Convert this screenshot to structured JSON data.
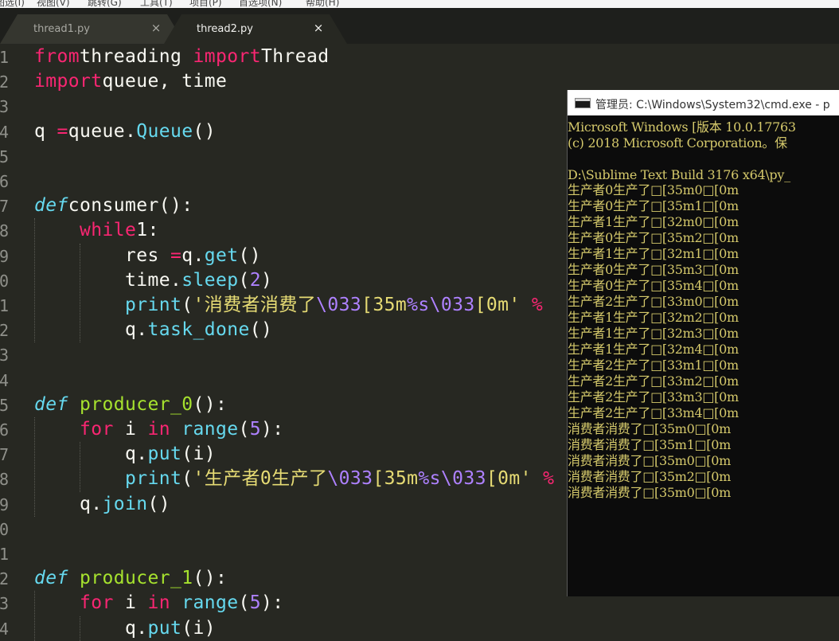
{
  "menu_bar": {
    "items": [
      "图选(I)",
      "视图(V)",
      "跳转(G)",
      "工具(T)",
      "项目(P)",
      "首选项(N)",
      "帮助(H)"
    ]
  },
  "tabs": [
    {
      "label": "thread1.py",
      "active": false
    },
    {
      "label": "thread2.py",
      "active": true
    }
  ],
  "tab_close_glyph": "×",
  "editor": {
    "line_numbers": [
      "1",
      "2",
      "3",
      "4",
      "5",
      "6",
      "7",
      "8",
      "9",
      "0",
      "1",
      "2",
      "3",
      "4",
      "5",
      "6",
      "7",
      "8",
      "9",
      "0",
      "1",
      "2",
      "3",
      "4"
    ],
    "lines": [
      [
        [
          "kw",
          "from"
        ],
        [
          "",
          "threading "
        ],
        [
          "kw",
          "import"
        ],
        [
          "",
          "Thread"
        ]
      ],
      [
        [
          "kw",
          "import"
        ],
        [
          "",
          "queue, time"
        ]
      ],
      [],
      [
        [
          "",
          "q "
        ],
        [
          "kw",
          "="
        ],
        [
          "",
          "queue."
        ],
        [
          "bi",
          "Queue"
        ],
        [
          "",
          "()"
        ]
      ],
      [],
      [],
      [
        [
          "def",
          "def"
        ],
        [
          "",
          "consumer():"
        ]
      ],
      [
        [
          "",
          "    "
        ],
        [
          "kw",
          "while"
        ],
        [
          "",
          "1:"
        ]
      ],
      [
        [
          "",
          "        res "
        ],
        [
          "kw",
          "="
        ],
        [
          "",
          "q."
        ],
        [
          "bi",
          "get"
        ],
        [
          "",
          "()"
        ]
      ],
      [
        [
          "",
          "        time."
        ],
        [
          "bi",
          "sleep"
        ],
        [
          "",
          "("
        ],
        [
          "num",
          "2"
        ],
        [
          "",
          ")"
        ]
      ],
      [
        [
          "",
          "        "
        ],
        [
          "bi",
          "print"
        ],
        [
          "",
          "("
        ],
        [
          "str",
          "'消费者消费了"
        ],
        [
          "esc",
          "\\033"
        ],
        [
          "str",
          "[35m"
        ],
        [
          "esc",
          "%s"
        ],
        [
          "esc",
          "\\033"
        ],
        [
          "str",
          "[0m'"
        ],
        [
          "kw",
          " %"
        ]
      ],
      [
        [
          "",
          "        q."
        ],
        [
          "bi",
          "task_done"
        ],
        [
          "",
          "()"
        ]
      ],
      [],
      [],
      [
        [
          "def",
          "def"
        ],
        [
          "fn",
          " producer_0"
        ],
        [
          "",
          "():"
        ]
      ],
      [
        [
          "",
          "    "
        ],
        [
          "kw",
          "for"
        ],
        [
          "",
          " i "
        ],
        [
          "kw",
          "in"
        ],
        [
          "",
          " "
        ],
        [
          "bi",
          "range"
        ],
        [
          "",
          "("
        ],
        [
          "num",
          "5"
        ],
        [
          "",
          "):"
        ]
      ],
      [
        [
          "",
          "        q."
        ],
        [
          "bi",
          "put"
        ],
        [
          "",
          "(i)"
        ]
      ],
      [
        [
          "",
          "        "
        ],
        [
          "bi",
          "print"
        ],
        [
          "",
          "("
        ],
        [
          "str",
          "'生产者0生产了"
        ],
        [
          "esc",
          "\\033"
        ],
        [
          "str",
          "[35m"
        ],
        [
          "esc",
          "%s"
        ],
        [
          "esc",
          "\\033"
        ],
        [
          "str",
          "[0m'"
        ],
        [
          "kw",
          " %"
        ]
      ],
      [
        [
          "",
          "    q."
        ],
        [
          "bi",
          "join"
        ],
        [
          "",
          "()"
        ]
      ],
      [],
      [],
      [
        [
          "def",
          "def"
        ],
        [
          "fn",
          " producer_1"
        ],
        [
          "",
          "():"
        ]
      ],
      [
        [
          "",
          "    "
        ],
        [
          "kw",
          "for"
        ],
        [
          "",
          " i "
        ],
        [
          "kw",
          "in"
        ],
        [
          "",
          " "
        ],
        [
          "bi",
          "range"
        ],
        [
          "",
          "("
        ],
        [
          "num",
          "5"
        ],
        [
          "",
          "):"
        ]
      ],
      [
        [
          "",
          "        q."
        ],
        [
          "bi",
          "put"
        ],
        [
          "",
          "(i)"
        ]
      ]
    ]
  },
  "terminal": {
    "title": "管理员: C:\\Windows\\System32\\cmd.exe - p",
    "lines": [
      "Microsoft Windows [版本 10.0.17763",
      "(c) 2018 Microsoft Corporation。保",
      "",
      "D:\\Sublime Text Build 3176 x64\\py_",
      "生产者0生产了□[35m0□[0m",
      "生产者0生产了□[35m1□[0m",
      "生产者1生产了□[32m0□[0m",
      "生产者0生产了□[35m2□[0m",
      "生产者1生产了□[32m1□[0m",
      "生产者0生产了□[35m3□[0m",
      "生产者0生产了□[35m4□[0m",
      "生产者2生产了□[33m0□[0m",
      "生产者1生产了□[32m2□[0m",
      "生产者1生产了□[32m3□[0m",
      "生产者1生产了□[32m4□[0m",
      "生产者2生产了□[33m1□[0m",
      "生产者2生产了□[33m2□[0m",
      "生产者2生产了□[33m3□[0m",
      "生产者2生产了□[33m4□[0m",
      "消费者消费了□[35m0□[0m",
      "消费者消费了□[35m1□[0m",
      "消费者消费了□[35m0□[0m",
      "消费者消费了□[35m2□[0m",
      "消费者消费了□[35m0□[0m"
    ]
  },
  "colors": {
    "editor_bg": "#272822",
    "keyword": "#f92672",
    "builtin": "#66d9ef",
    "function_name": "#a6e22e",
    "string": "#e6db74",
    "number": "#ae81ff",
    "terminal_text": "#d5c96b"
  }
}
